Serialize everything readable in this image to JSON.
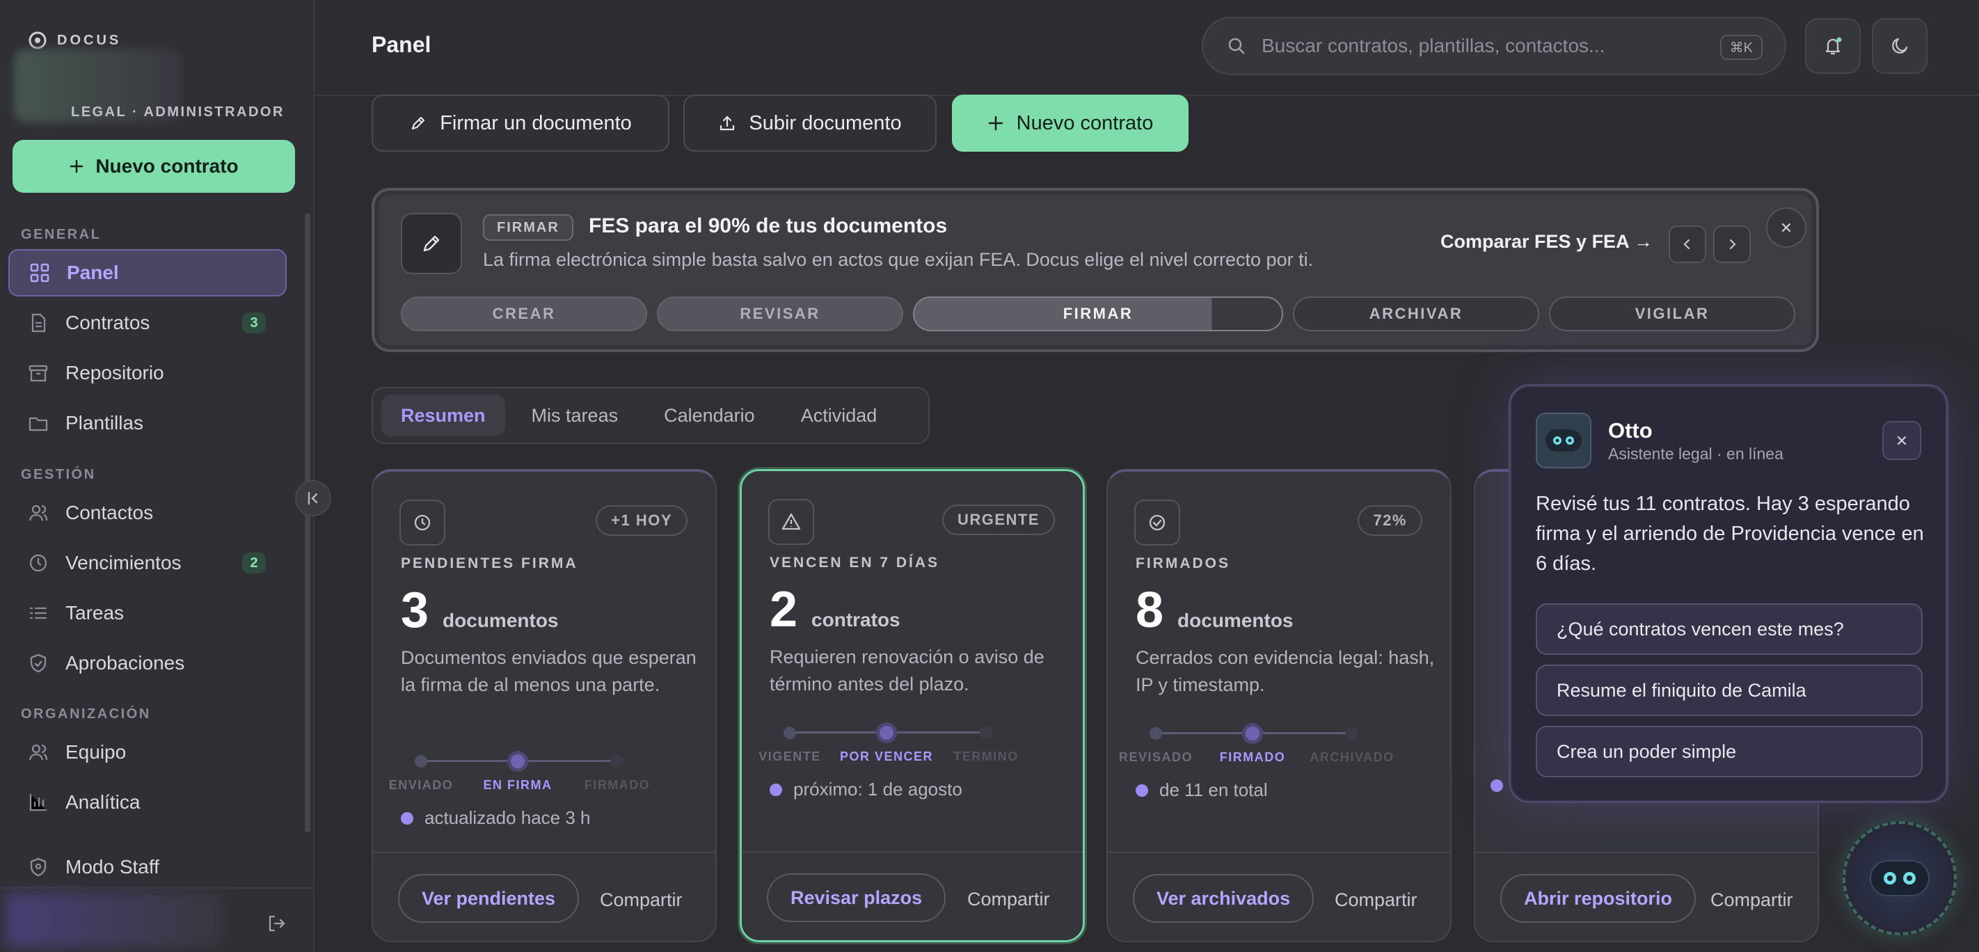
{
  "sidebar": {
    "logo_text": "DOCUS",
    "role": "LEGAL · ADMINISTRADOR",
    "new_contract": "Nuevo contrato",
    "sections": {
      "general": "GENERAL",
      "gestion": "GESTIÓN",
      "organizacion": "ORGANIZACIÓN"
    },
    "items": [
      {
        "label": "Panel",
        "icon": "grid-icon",
        "active": true
      },
      {
        "label": "Contratos",
        "icon": "document-icon",
        "badge": "3"
      },
      {
        "label": "Repositorio",
        "icon": "archive-icon"
      },
      {
        "label": "Plantillas",
        "icon": "folder-icon"
      },
      {
        "label": "Contactos",
        "icon": "users-icon"
      },
      {
        "label": "Vencimientos",
        "icon": "clock-icon",
        "badge": "2"
      },
      {
        "label": "Tareas",
        "icon": "list-icon"
      },
      {
        "label": "Aprobaciones",
        "icon": "shield-check-icon"
      },
      {
        "label": "Equipo",
        "icon": "team-icon"
      },
      {
        "label": "Analítica",
        "icon": "bar-chart-icon"
      },
      {
        "label": "Modo Staff",
        "icon": "shield-icon"
      }
    ]
  },
  "header": {
    "title": "Panel",
    "search_placeholder": "Buscar contratos, plantillas, contactos...",
    "shortcut": "⌘K"
  },
  "actions": {
    "sign": "Firmar un documento",
    "upload": "Subir documento",
    "new": "Nuevo contrato"
  },
  "banner": {
    "tag": "FIRMAR",
    "title": "FES para el 90% de tus documentos",
    "description": "La firma electrónica simple basta salvo en actos que exijan FEA. Docus elige el nivel correcto por ti.",
    "link": "Comparar FES y FEA →",
    "steps": [
      "CREAR",
      "REVISAR",
      "FIRMAR",
      "ARCHIVAR",
      "VIGILAR"
    ],
    "current_step": "FIRMAR"
  },
  "tabs": [
    "Resumen",
    "Mis tareas",
    "Calendario",
    "Actividad"
  ],
  "active_tab": "Resumen",
  "cards": [
    {
      "badge": "+1 HOY",
      "label": "PENDIENTES FIRMA",
      "number": "3",
      "unit": "documentos",
      "description": "Documentos enviados que esperan la firma de al menos una parte.",
      "timeline": [
        "ENVIADO",
        "EN FIRMA",
        "FIRMADO"
      ],
      "meta": "actualizado hace 3 h",
      "action": "Ver pendientes",
      "share": "Compartir"
    },
    {
      "badge": "URGENTE",
      "label": "VENCEN EN 7 DÍAS",
      "number": "2",
      "unit": "contratos",
      "description": "Requieren renovación o aviso de término antes del plazo.",
      "timeline": [
        "VIGENTE",
        "POR VENCER",
        "TERMINO"
      ],
      "meta": "próximo: 1 de agosto",
      "action": "Revisar plazos",
      "share": "Compartir"
    },
    {
      "badge": "72%",
      "label": "FIRMADOS",
      "number": "8",
      "unit": "documentos",
      "description": "Cerrados con evidencia legal: hash, IP y timestamp.",
      "timeline": [
        "REVISADO",
        "FIRMADO",
        "ARCHIVADO"
      ],
      "meta": "de 11 en total",
      "action": "Ver archivados",
      "share": "Compartir"
    },
    {
      "action": "Abrir repositorio",
      "share": "Compartir"
    }
  ],
  "assistant": {
    "name": "Otto",
    "subtitle": "Asistente legal · en línea",
    "message": "Revisé tus 11 contratos. Hay 3 esperando firma y el arriendo de Providencia vence en 6 días.",
    "suggestions": [
      "¿Qué contratos vencen este mes?",
      "Resume el finiquito de Camila",
      "Crea un poder simple"
    ]
  },
  "colors": {
    "accent_green": "#7fdcab",
    "accent_purple": "#a898ff",
    "background": "#2b2b30"
  }
}
